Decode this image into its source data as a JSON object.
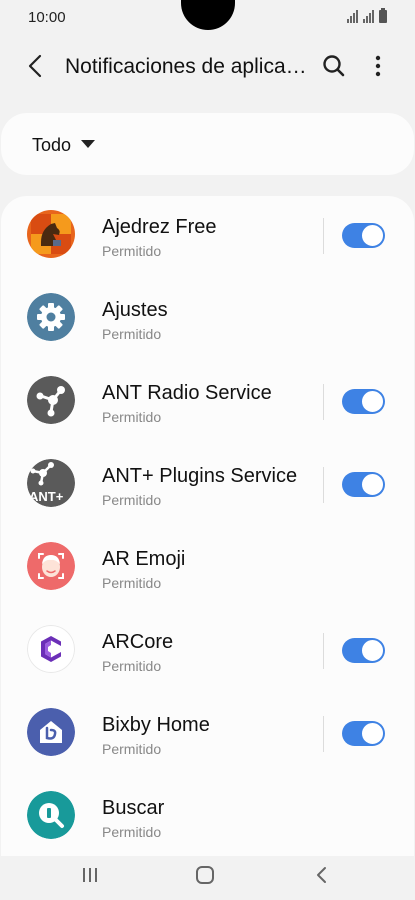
{
  "status_bar": {
    "time": "10:00"
  },
  "header": {
    "title": "Notificaciones de aplicaciones"
  },
  "filter": {
    "label": "Todo"
  },
  "apps": [
    {
      "name": "Ajedrez Free",
      "status": "Permitido",
      "icon": "chess-icon",
      "has_toggle": true,
      "enabled": true
    },
    {
      "name": "Ajustes",
      "status": "Permitido",
      "icon": "gear-icon",
      "has_toggle": false,
      "enabled": true
    },
    {
      "name": "ANT Radio Service",
      "status": "Permitido",
      "icon": "ant-radio-icon",
      "has_toggle": true,
      "enabled": true
    },
    {
      "name": "ANT+ Plugins Service",
      "status": "Permitido",
      "icon": "ant-plugins-icon",
      "icon_text": "ANT+",
      "has_toggle": true,
      "enabled": true
    },
    {
      "name": "AR Emoji",
      "status": "Permitido",
      "icon": "ar-emoji-icon",
      "has_toggle": false,
      "enabled": true
    },
    {
      "name": "ARCore",
      "status": "Permitido",
      "icon": "arcore-icon",
      "has_toggle": true,
      "enabled": true
    },
    {
      "name": "Bixby Home",
      "status": "Permitido",
      "icon": "bixby-home-icon",
      "has_toggle": true,
      "enabled": true
    },
    {
      "name": "Buscar",
      "status": "Permitido",
      "icon": "search-app-icon",
      "has_toggle": false,
      "enabled": true
    }
  ],
  "colors": {
    "accent": "#3e82e4",
    "background": "#f2f2f2",
    "card": "#fcfcfc"
  }
}
